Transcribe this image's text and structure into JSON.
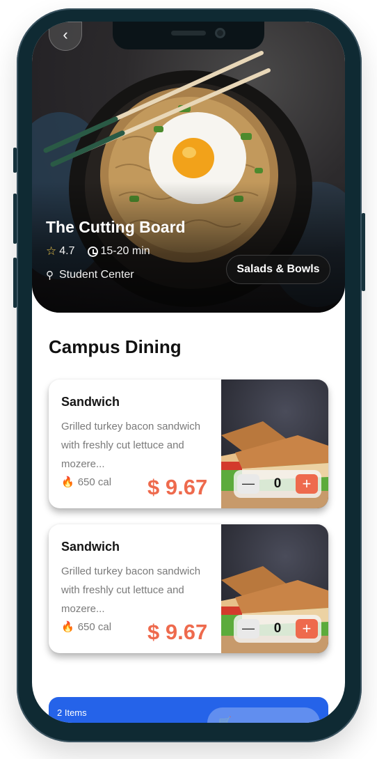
{
  "restaurant": {
    "name": "The Cutting Board",
    "rating": "4.7",
    "delivery_time": "15-20 min",
    "location": "Student Center",
    "category": "Salads & Bowls"
  },
  "section_title": "Campus Dining",
  "items": [
    {
      "title": "Sandwich",
      "description": "Grilled turkey bacon sandwich with freshly cut lettuce and mozere...",
      "calories": "650 cal",
      "price": "$ 9.67",
      "quantity": "0",
      "minus": "—",
      "plus": "+"
    },
    {
      "title": "Sandwich",
      "description": "Grilled turkey bacon sandwich with freshly cut lettuce and mozere...",
      "calories": "650 cal",
      "price": "$ 9.67",
      "quantity": "0",
      "minus": "—",
      "plus": "+"
    }
  ],
  "cart": {
    "count_label": "2 Items"
  },
  "icons": {
    "back": "‹",
    "star": "☆",
    "pin": "⚲",
    "flame": "🔥"
  },
  "colors": {
    "accent": "#ee6a4d",
    "cart_bar": "#2563e9",
    "star": "#f2c94c"
  }
}
